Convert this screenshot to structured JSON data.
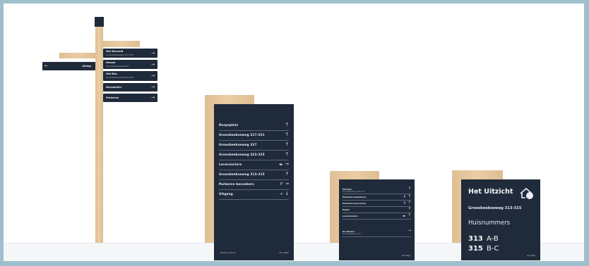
{
  "colors": {
    "navy": "#1f2a3a",
    "wood": "#e9c79a",
    "background": "#9ebfcc"
  },
  "fingerpost": {
    "left_arm": {
      "label": "Afslag",
      "icon": "arrow-left-icon"
    },
    "arms": [
      {
        "title": "Het Bosveld",
        "subtitle": "Groesbeekseweg 317-321",
        "icon": "arrow-right-icon"
      },
      {
        "title": "Hessel",
        "subtitle": "Groesbeekseweg 327",
        "icon": "arrow-right-icon"
      },
      {
        "title": "Het Bos",
        "subtitle": "Groesbeekseweg 305-315",
        "icon": "arrow-right-icon"
      },
      {
        "title": "Dorpsplein",
        "subtitle": "",
        "icon": "arrow-right-icon"
      },
      {
        "title": "Parkeren",
        "subtitle": "",
        "icon": "arrow-right-icon"
      }
    ]
  },
  "large_sign": {
    "rows": [
      {
        "label": "Dorpsplein",
        "icon": "",
        "arrow": "↑"
      },
      {
        "label": "Groesbeekseweg 317-321",
        "icon": "",
        "arrow": "↑"
      },
      {
        "label": "Groesbeekseweg 327",
        "icon": "",
        "arrow": "↑"
      },
      {
        "label": "Groesbeekseweg 323-325",
        "icon": "",
        "arrow": "↑"
      },
      {
        "label": "Leveranciers",
        "icon": "▬",
        "arrow": "→"
      },
      {
        "label": "Groesbeekseweg 313-315",
        "icon": "",
        "arrow": "↑"
      },
      {
        "label": "Parkeren bezoekers",
        "icon": "P",
        "arrow": "→"
      },
      {
        "label": "Uitgang",
        "icon": "⇥",
        "arrow": "↓"
      }
    ],
    "footer_left": "Jansen & Zoon",
    "footer_right": "de uitkijk"
  },
  "small_sign": {
    "rows": [
      {
        "label": "Het Bos",
        "sub": "Groesbeekseweg 305-315",
        "icon": "",
        "arrow": "↑"
      },
      {
        "label": "Parkeren bezoekers",
        "sub": "",
        "icon": "P",
        "arrow": "↑"
      },
      {
        "label": "Parkeren personeel",
        "sub": "",
        "icon": "P",
        "arrow": "↑"
      },
      {
        "label": "Kapel",
        "sub": "",
        "icon": "",
        "arrow": "↑"
      },
      {
        "label": "Leveranciers",
        "sub": "",
        "icon": "▬",
        "arrow": "↑"
      }
    ],
    "extra_row": {
      "label": "De Hessel",
      "sub": "Groesbeekseweg 327",
      "arrow": "→"
    },
    "footer_right": "de uitkijk"
  },
  "entrance_sign": {
    "title": "Het Uitzicht",
    "address": "Groesbeekseweg 313-315",
    "section_label": "Huisnummers",
    "numbers": [
      {
        "num": "313",
        "suffix": "A-B"
      },
      {
        "num": "315",
        "suffix": "B-C"
      }
    ],
    "logo_icon": "house-logo-icon",
    "footer_right": "de uitkijk"
  }
}
